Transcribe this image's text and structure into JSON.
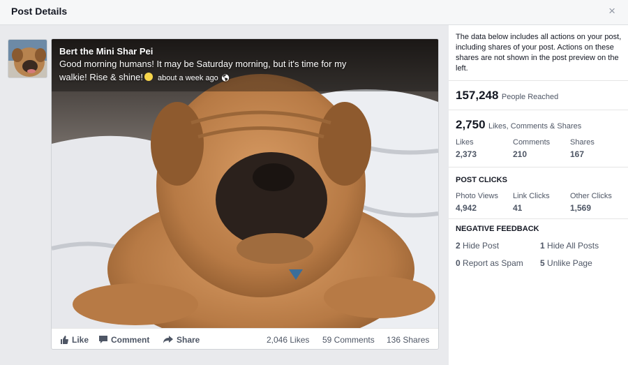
{
  "header": {
    "title": "Post Details",
    "close_label": "×"
  },
  "post": {
    "page_name": "Bert the Mini Shar Pei",
    "message_line1": "Good morning humans! It may be Saturday morning, but it's time for my",
    "message_line2": "walkie! Rise & shine!",
    "timestamp": "about a week ago",
    "actions": {
      "like": "Like",
      "comment": "Comment",
      "share": "Share"
    },
    "stats": {
      "likes": "2,046 Likes",
      "comments": "59 Comments",
      "shares": "136 Shares"
    }
  },
  "insights": {
    "description": "The data below includes all actions on your post, including shares of your post. Actions on these shares are not shown in the post preview on the left.",
    "reach": {
      "value": "157,248",
      "label": "People Reached"
    },
    "engagement": {
      "value": "2,750",
      "label": "Likes, Comments & Shares",
      "items": [
        {
          "label": "Likes",
          "value": "2,373"
        },
        {
          "label": "Comments",
          "value": "210"
        },
        {
          "label": "Shares",
          "value": "167"
        }
      ]
    },
    "post_clicks": {
      "heading": "POST CLICKS",
      "items": [
        {
          "label": "Photo Views",
          "value": "4,942"
        },
        {
          "label": "Link Clicks",
          "value": "41"
        },
        {
          "label": "Other Clicks",
          "value": "1,569"
        }
      ]
    },
    "negative_feedback": {
      "heading": "NEGATIVE FEEDBACK",
      "items": [
        {
          "count": "2",
          "label": "Hide Post"
        },
        {
          "count": "1",
          "label": "Hide All Posts"
        },
        {
          "count": "0",
          "label": "Report as Spam"
        },
        {
          "count": "5",
          "label": "Unlike Page"
        }
      ]
    }
  },
  "colors": {
    "accent_text": "#4e5665",
    "header_bg": "#f6f7f8",
    "left_bg": "#e9eaed"
  }
}
